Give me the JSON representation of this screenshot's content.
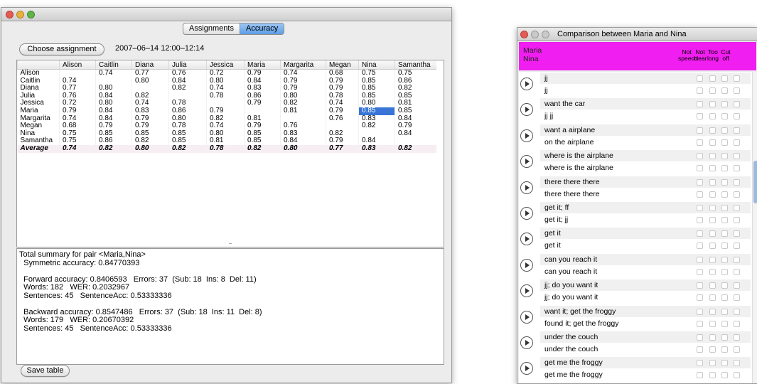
{
  "main_window": {
    "tabs": [
      "Assignments",
      "Accuracy"
    ],
    "choose_button": "Choose assignment",
    "session_label": "2007–06–14 12:00–12:14",
    "save_button": "Save table"
  },
  "accuracy_table": {
    "columns": [
      "",
      "Alison",
      "Caitlin",
      "Diana",
      "Julia",
      "Jessica",
      "Maria",
      "Margarita",
      "Megan",
      "Nina",
      "Samantha"
    ],
    "rows": [
      [
        "Alison",
        "",
        "0.74",
        "0.77",
        "0.76",
        "0.72",
        "0.79",
        "0.74",
        "0.68",
        "0.75",
        "0.75"
      ],
      [
        "Caitlin",
        "0.74",
        "",
        "0.80",
        "0.84",
        "0.80",
        "0.84",
        "0.79",
        "0.79",
        "0.85",
        "0.86"
      ],
      [
        "Diana",
        "0.77",
        "0.80",
        "",
        "0.82",
        "0.74",
        "0.83",
        "0.79",
        "0.79",
        "0.85",
        "0.82"
      ],
      [
        "Julia",
        "0.76",
        "0.84",
        "0.82",
        "",
        "0.78",
        "0.86",
        "0.80",
        "0.78",
        "0.85",
        "0.85"
      ],
      [
        "Jessica",
        "0.72",
        "0.80",
        "0.74",
        "0.78",
        "",
        "0.79",
        "0.82",
        "0.74",
        "0.80",
        "0.81"
      ],
      [
        "Maria",
        "0.79",
        "0.84",
        "0.83",
        "0.86",
        "0.79",
        "",
        "0.81",
        "0.79",
        "0.85",
        "0.85"
      ],
      [
        "Margarita",
        "0.74",
        "0.84",
        "0.79",
        "0.80",
        "0.82",
        "0.81",
        "",
        "0.76",
        "0.83",
        "0.84"
      ],
      [
        "Megan",
        "0.68",
        "0.79",
        "0.79",
        "0.78",
        "0.74",
        "0.79",
        "0.76",
        "",
        "0.82",
        "0.79"
      ],
      [
        "Nina",
        "0.75",
        "0.85",
        "0.85",
        "0.85",
        "0.80",
        "0.85",
        "0.83",
        "0.82",
        "",
        "0.84"
      ],
      [
        "Samantha",
        "0.75",
        "0.86",
        "0.82",
        "0.85",
        "0.81",
        "0.85",
        "0.84",
        "0.79",
        "0.84",
        ""
      ]
    ],
    "average": [
      "Average",
      "0.74",
      "0.82",
      "0.80",
      "0.82",
      "0.78",
      "0.82",
      "0.80",
      "0.77",
      "0.83",
      "0.82"
    ],
    "selected_cell": {
      "row": "Maria",
      "column": "Nina"
    }
  },
  "summary": [
    "Total summary for pair <Maria,Nina>",
    "  Symmetric accuracy: 0.84770393",
    "",
    "  Forward accuracy: 0.8406593   Errors: 37  (Sub: 18  Ins: 8  Del: 11)",
    "  Words: 182   WER: 0.2032967",
    "  Sentences: 45   SentenceAcc: 0.53333336",
    "",
    "  Backward accuracy: 0.8547486   Errors: 37  (Sub: 18  Ins: 11  Del: 8)",
    "  Words: 179   WER: 0.20670392",
    "  Sentences: 45   SentenceAcc: 0.53333336"
  ],
  "comparison_window": {
    "title": "Comparison between Maria and Nina",
    "speaker1": "Maria",
    "speaker2": "Nina",
    "header_color": "#f01ef0",
    "flag_columns": [
      {
        "top": "Not",
        "bottom": "speech"
      },
      {
        "top": "Not",
        "bottom": "clear"
      },
      {
        "top": "Too",
        "bottom": "long"
      },
      {
        "top": "Cut",
        "bottom": "off"
      }
    ],
    "pairs": [
      {
        "a": "jj",
        "b": "jj"
      },
      {
        "a": "want the car",
        "b": "jj jj"
      },
      {
        "a": "want a airplane",
        "b": "on the airplane"
      },
      {
        "a": "where is the airplane",
        "b": "where is the airplane"
      },
      {
        "a": "there there there",
        "b": "there there there"
      },
      {
        "a": "get it; ff",
        "b": "get it; jj"
      },
      {
        "a": "get it",
        "b": "get it"
      },
      {
        "a": "can you reach it",
        "b": "can you reach it"
      },
      {
        "a": "jj; do you want it",
        "b": "jj; do you want it"
      },
      {
        "a": "want it; get the froggy",
        "b": "found it; get the froggy"
      },
      {
        "a": "under the couch",
        "b": "under the couch"
      },
      {
        "a": "get me the froggy",
        "b": "get me the froggy"
      }
    ]
  }
}
